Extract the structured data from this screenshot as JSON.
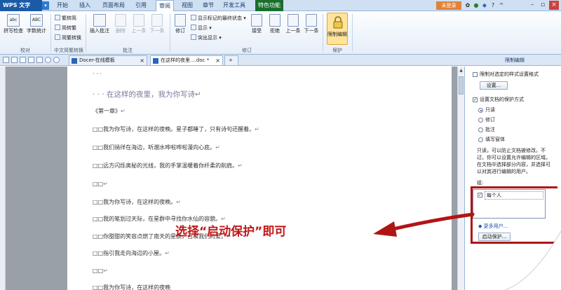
{
  "titlebar": {
    "app_name": "WPS 文字",
    "menu_tabs": [
      {
        "label": "开始",
        "active": false
      },
      {
        "label": "插入",
        "active": false
      },
      {
        "label": "页面布局",
        "active": false
      },
      {
        "label": "引用",
        "active": false
      },
      {
        "label": "审阅",
        "active": true
      },
      {
        "label": "视图",
        "active": false
      },
      {
        "label": "章节",
        "active": false
      },
      {
        "label": "开发工具",
        "active": false
      },
      {
        "label": "特色功能",
        "active": false
      }
    ],
    "login_label": "未登录"
  },
  "ribbon": {
    "spellcheck": "拼写检查",
    "wordcount": "字数统计",
    "to_simplified": "繁转简",
    "to_traditional": "简转繁",
    "conversion": "简繁转换",
    "insert_comment": "插入批注",
    "delete": "删除",
    "prev": "上一条",
    "next": "下一条",
    "revise": "修订",
    "show_markup_dropdown": "显示标记的最终状态",
    "show": "显示",
    "balloon": "突出显示",
    "accept": "接受",
    "reject": "拒绝",
    "prev_change": "上一条",
    "next_change": "下一条",
    "restrict_editing": "限制编辑",
    "groups": {
      "proofing": "校对",
      "chinese_conversion": "中文简繁转换",
      "comments": "批注",
      "tracking": "修订",
      "protect": "保护"
    }
  },
  "tabs": {
    "docer": "Docer-在线模板",
    "document": "在这样的夜里....doc *",
    "add": "+",
    "panel_title": "限制编辑"
  },
  "document": {
    "lines": [
      "· · ·",
      "· · · 在这样的夜里，我为你写诗",
      "《第一章》",
      "□□我为你写诗，在这样的夜晚。星子都睡了，只有诗句还醒着。",
      "□□我们徜徉在海边，听潮水哗啦哗啦漫向心底。",
      "□□远方闪烁奥秘的光线，我的手掌温暖着你纤柔的削肩。",
      "□□",
      "□□我为你写诗，在这样的夜晚。",
      "□□我的笔划过天际，在星群中寻找你水仙的容貌。",
      "□□你甜甜的笑容点燃了南天的星辰，召唤我们的爱。",
      "□□指引我走向海边的小屋。",
      "□□",
      "□□我为你写诗，在这样的夜晚"
    ],
    "return_mark": "↵"
  },
  "panel": {
    "format_limit": "限制对选定的样式设置格式",
    "settings_button": "设置...",
    "protect_method": "设置文档的保护方式",
    "options": [
      "只读",
      "修订",
      "批注",
      "填写窗体"
    ],
    "selected_option": "只读",
    "description": [
      "只读，可以防止文档被修改。不",
      "过，你可以设置允许编辑的区域。",
      "在文档中选择部分内容，并选择可",
      "以对其进行编辑的用户。"
    ],
    "group_label": "组:",
    "group_everyone": "每个人",
    "more_users": "更多用户...",
    "start_protect_button": "启动保护..."
  },
  "annotation": {
    "text": "选择“启动保护”即可",
    "color": "#c01717"
  }
}
